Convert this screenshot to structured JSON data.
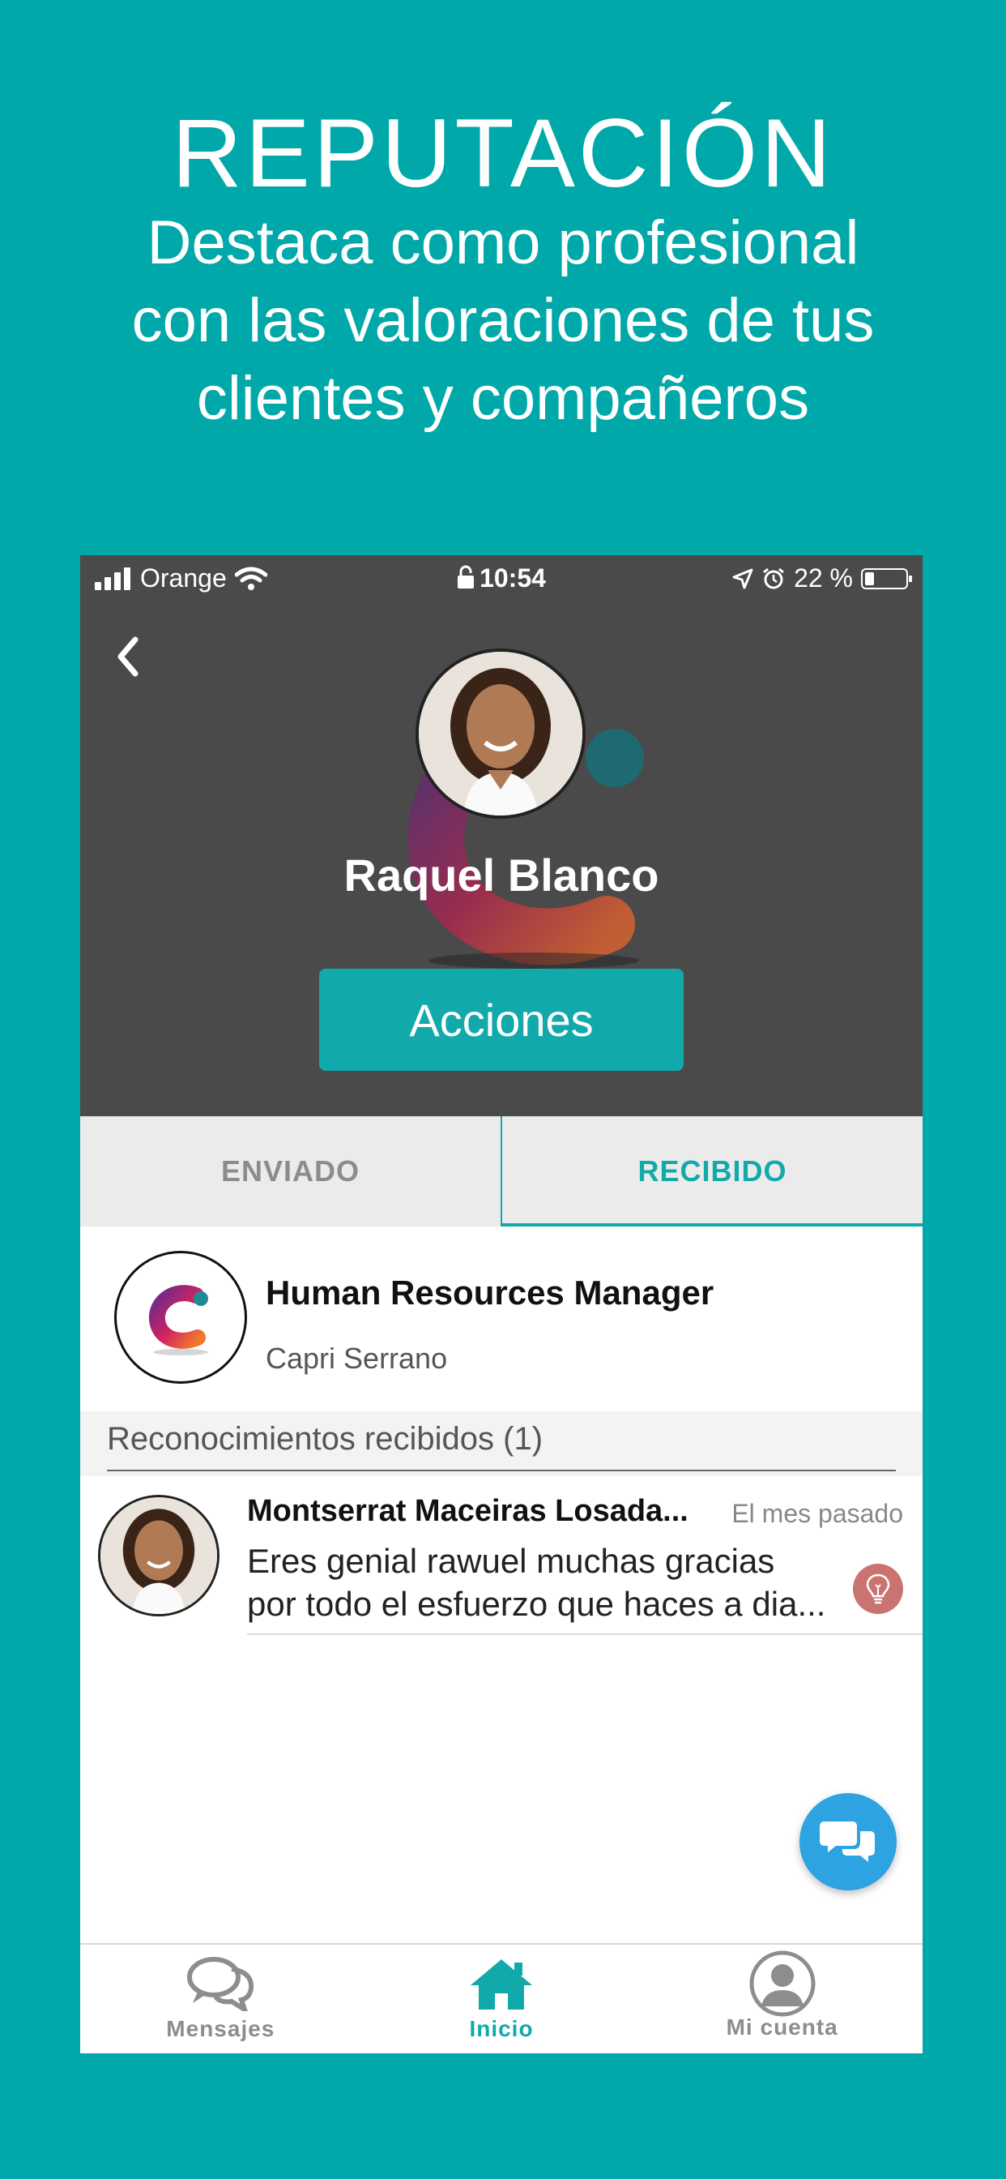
{
  "colors": {
    "background": "#00a8aa",
    "accent": "#12a9ab",
    "header": "#4a4a4a",
    "fab": "#2ea3e2",
    "badge": "#c97470"
  },
  "promo": {
    "title": "REPUTACIÓN",
    "subtitle_lines": [
      "Destaca como profesional",
      "con las valoraciones de tus",
      "clientes y compañeros"
    ]
  },
  "status_bar": {
    "carrier": "Orange",
    "time": "10:54",
    "battery": "22 %",
    "battery_level": 0.22
  },
  "profile": {
    "name": "Raquel Blanco",
    "actions_label": "Acciones"
  },
  "tabs": [
    {
      "label": "ENVIADO",
      "active": false
    },
    {
      "label": "RECIBIDO",
      "active": true
    }
  ],
  "company": {
    "title": "Human Resources Manager",
    "subtitle": "Capri Serrano"
  },
  "recognitions": {
    "heading": "Reconocimientos recibidos (1)",
    "items": [
      {
        "author": "Montserrat Maceiras Losada...",
        "date": "El mes pasado",
        "text_lines": [
          "Eres genial rawuel muchas gracias",
          "por todo el esfuerzo que haces a dia..."
        ],
        "badge_icon": "lightbulb-icon"
      }
    ]
  },
  "bottom_nav": [
    {
      "label": "Mensajes",
      "icon": "chat-bubbles-icon",
      "active": false
    },
    {
      "label": "Inicio",
      "icon": "home-icon",
      "active": true
    },
    {
      "label": "Mi cuenta",
      "icon": "user-icon",
      "active": false
    }
  ]
}
